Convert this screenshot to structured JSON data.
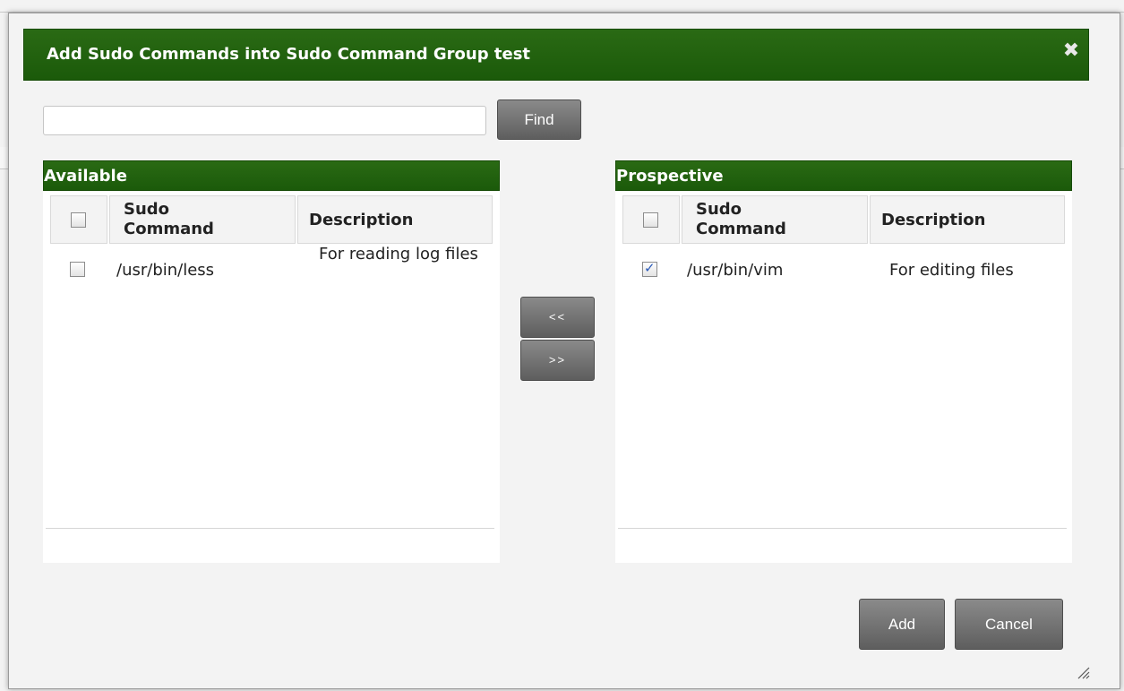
{
  "dialog": {
    "title": "Add Sudo Commands into Sudo Command Group test",
    "close_glyph": "✖"
  },
  "search": {
    "value": "",
    "placeholder": "",
    "find_label": "Find"
  },
  "available": {
    "header": "Available",
    "columns": [
      "Sudo Command",
      "Description"
    ],
    "rows": [
      {
        "command": "/usr/bin/less",
        "description": "For reading log files",
        "checked": false
      }
    ]
  },
  "prospective": {
    "header": "Prospective",
    "columns": [
      "Sudo Command",
      "Description"
    ],
    "rows": [
      {
        "command": "/usr/bin/vim",
        "description": "For editing files",
        "checked": true
      }
    ]
  },
  "transfer": {
    "move_left_label": "<<",
    "move_right_label": ">>"
  },
  "footer": {
    "add_label": "Add",
    "cancel_label": "Cancel"
  },
  "icons": {
    "close": "close-icon",
    "resize": "resize-grip-icon",
    "check": "checkmark-icon"
  },
  "colors": {
    "header_green": "#1b5a0a",
    "button_gray": "#6e6e6e",
    "check_blue": "#2a5ab8"
  }
}
